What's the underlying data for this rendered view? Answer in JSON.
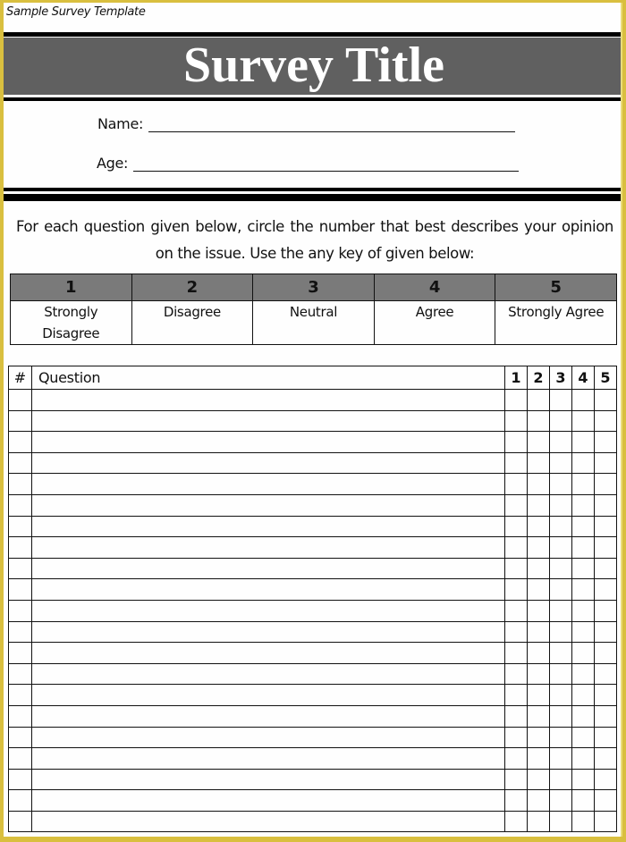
{
  "document": {
    "label": "Sample Survey Template",
    "title": "Survey Title"
  },
  "fields": {
    "name_label": "Name:",
    "name_value": "",
    "age_label": "Age:",
    "age_value": ""
  },
  "instructions": "For each question given below, circle the number that best describes your opinion on the issue. Use the any key of given below:",
  "rating_key": [
    {
      "value": "1",
      "label": "Strongly Disagree"
    },
    {
      "value": "2",
      "label": "Disagree"
    },
    {
      "value": "3",
      "label": "Neutral"
    },
    {
      "value": "4",
      "label": "Agree"
    },
    {
      "value": "5",
      "label": "Strongly Agree"
    }
  ],
  "question_table": {
    "headers": {
      "number": "#",
      "question": "Question",
      "scale": [
        "1",
        "2",
        "3",
        "4",
        "5"
      ]
    },
    "row_count": 21,
    "rows": []
  },
  "colors": {
    "frame": "#d9bf3f",
    "title_band": "#606060",
    "key_header": "#7a7a7a"
  }
}
